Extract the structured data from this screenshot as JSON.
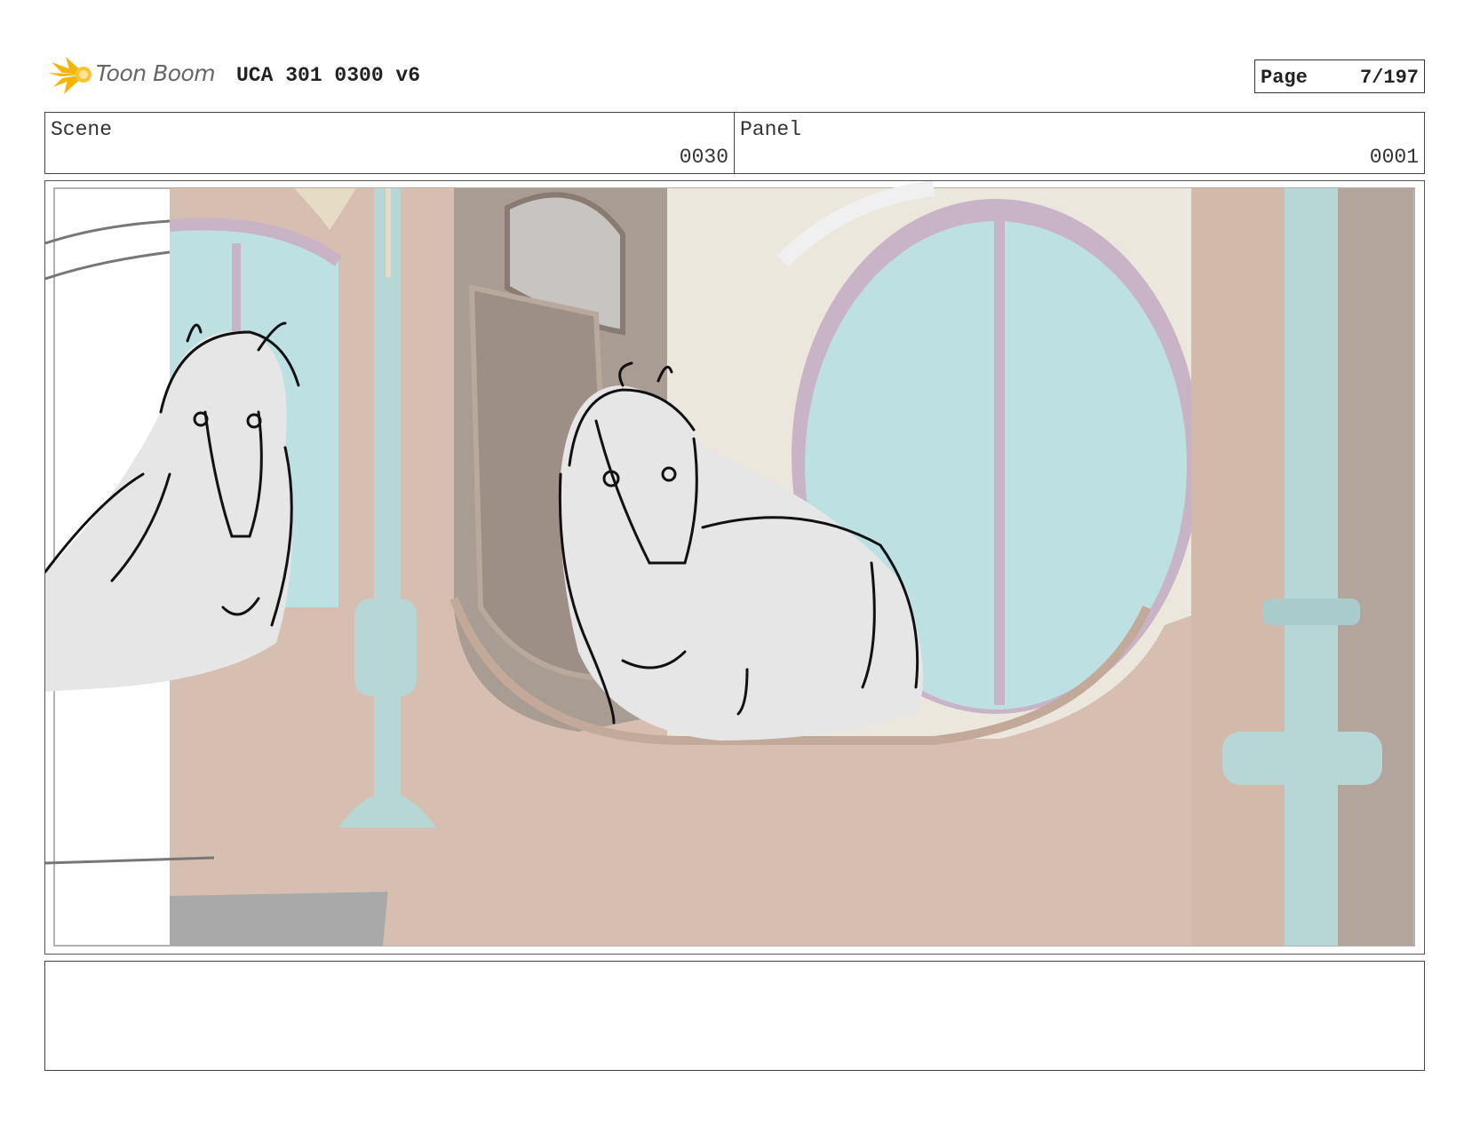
{
  "header": {
    "logo_text": "Toon Boom",
    "title": "UCA 301 0300 v6",
    "page_label": "Page",
    "page_value": "7/197"
  },
  "info": {
    "scene_label": "Scene",
    "scene_value": "0030",
    "panel_label": "Panel",
    "panel_value": "0001"
  },
  "panel_image": {
    "subject": "two horse sketches in a stable",
    "icon": "storyboard-drawing"
  },
  "notes": {
    "text": ""
  },
  "colors": {
    "wall": "#d6bfb0",
    "window_glass": "#bde0e2",
    "window_frame": "#c9b3c6",
    "pillar": "#b7d6d6",
    "horse_fill": "#e6e6e6",
    "logo": "#f4b400"
  }
}
